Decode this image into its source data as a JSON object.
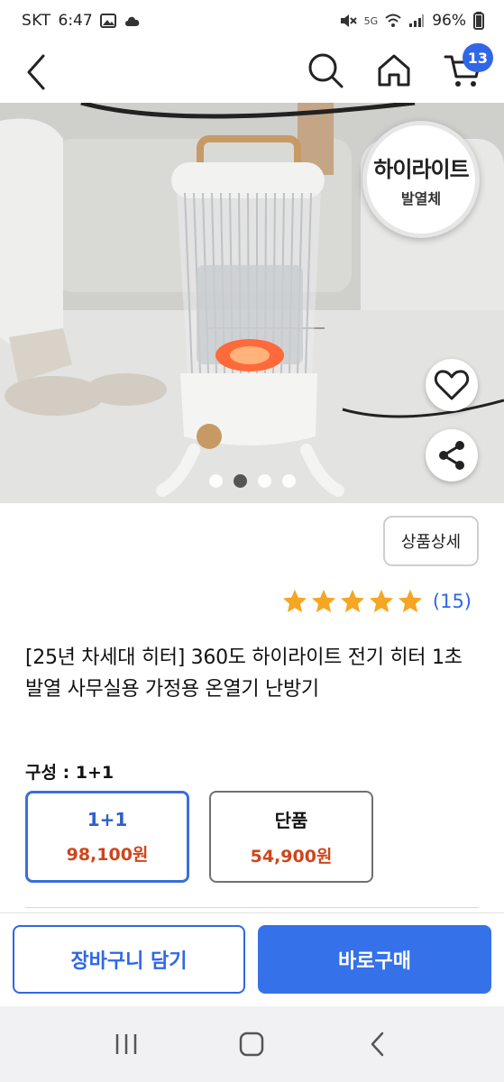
{
  "status_bar": {
    "carrier": "SKT",
    "time": "6:47",
    "network": "5G",
    "battery": "96%"
  },
  "header": {
    "cart_count": "13",
    "icons": [
      "back-chevron-icon",
      "search-icon",
      "home-icon",
      "cart-icon"
    ]
  },
  "product_image": {
    "badge_main": "하이라이트",
    "badge_sub": "발열체",
    "slide_count": 4,
    "active_slide": 2
  },
  "detail_button": "상품상세",
  "rating": {
    "stars": 5,
    "review_count": "(15)"
  },
  "title": "[25년 차세대 히터] 360도 하이라이트 전기 히터 1초 발열 사무실용 가정용 온열기 난방기",
  "option": {
    "label": "구성 : 1+1",
    "choices": [
      {
        "name": "1+1",
        "price": "98,100원",
        "selected": true
      },
      {
        "name": "단품",
        "price": "54,900원",
        "selected": false
      }
    ]
  },
  "actions": {
    "cart_label": "장바구니 담기",
    "buy_label": "바로구매"
  },
  "colors": {
    "accent": "#2f67e6",
    "price": "#d0451b",
    "star": "#f5a623"
  }
}
